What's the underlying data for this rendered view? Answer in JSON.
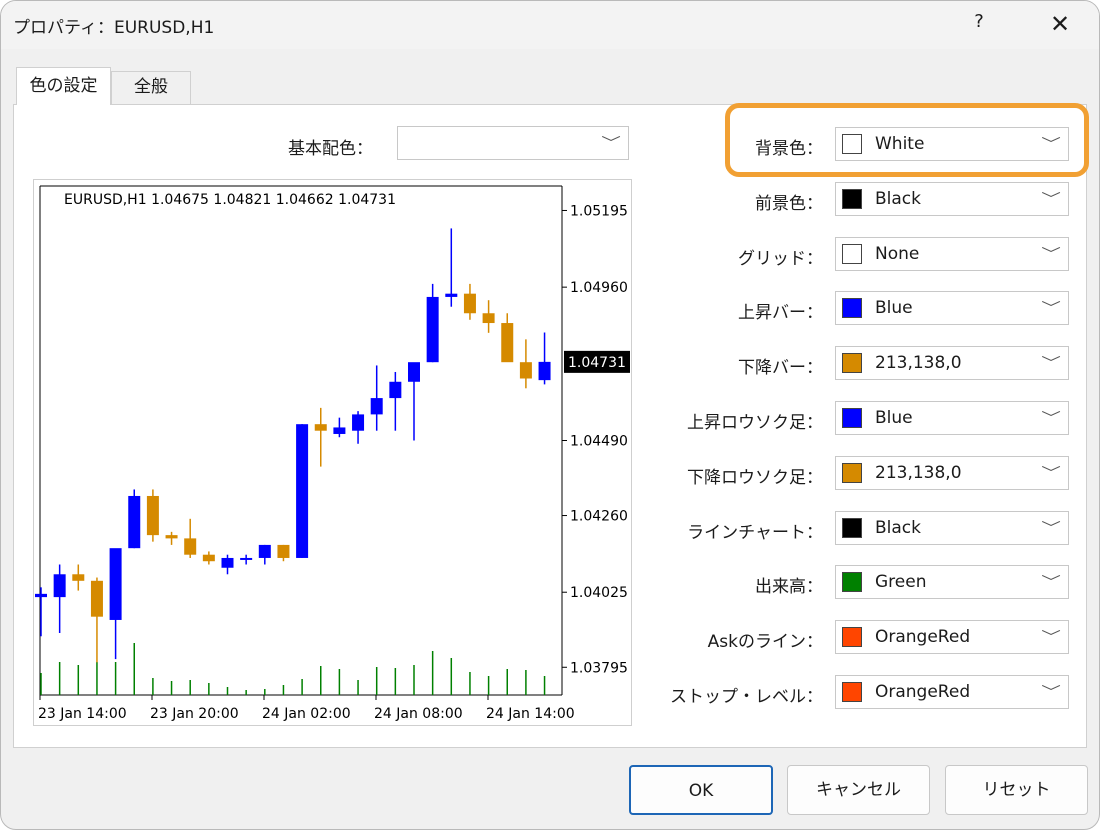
{
  "window": {
    "title": "プロパティ：EURUSD,H1",
    "help": "?",
    "close": "✕"
  },
  "tabs": [
    {
      "label": "色の設定"
    },
    {
      "label": "全般"
    }
  ],
  "scheme": {
    "label": "基本配色：",
    "value": ""
  },
  "settings": [
    {
      "label": "背景色：",
      "value": "White",
      "color": "#ffffff"
    },
    {
      "label": "前景色：",
      "value": "Black",
      "color": "#000000"
    },
    {
      "label": "グリッド：",
      "value": "None",
      "color": "#ffffff"
    },
    {
      "label": "上昇バー：",
      "value": "Blue",
      "color": "#0000ff"
    },
    {
      "label": "下降バー：",
      "value": "213,138,0",
      "color": "#d58a00"
    },
    {
      "label": "上昇ロウソク足：",
      "value": "Blue",
      "color": "#0000ff"
    },
    {
      "label": "下降ロウソク足：",
      "value": "213,138,0",
      "color": "#d58a00"
    },
    {
      "label": "ラインチャート：",
      "value": "Black",
      "color": "#000000"
    },
    {
      "label": "出来高：",
      "value": "Green",
      "color": "#008000"
    },
    {
      "label": "Askのライン：",
      "value": "OrangeRed",
      "color": "#ff4500"
    },
    {
      "label": "ストップ・レベル：",
      "value": "OrangeRed",
      "color": "#ff4500"
    }
  ],
  "buttons": {
    "ok": "OK",
    "cancel": "キャンセル",
    "reset": "リセット"
  },
  "chart_data": {
    "type": "candlestick",
    "header": "EURUSD,H1  1.04675 1.04821 1.04662 1.04731",
    "y_ticks": [
      "1.05195",
      "1.04960",
      "1.04490",
      "1.04260",
      "1.04025",
      "1.03795"
    ],
    "current_price": "1.04731",
    "x_ticks": [
      "23 Jan 14:00",
      "23 Jan 20:00",
      "24 Jan 02:00",
      "24 Jan 08:00",
      "24 Jan 14:00"
    ],
    "ylim": [
      1.0371,
      1.0527
    ],
    "up_color": "#0000ff",
    "down_color": "#d58a00",
    "volume_color": "#008000",
    "candles": [
      {
        "o": 1.0401,
        "h": 1.0404,
        "l": 1.0389,
        "c": 1.0402
      },
      {
        "o": 1.0401,
        "h": 1.0411,
        "l": 1.039,
        "c": 1.0408
      },
      {
        "o": 1.0408,
        "h": 1.0411,
        "l": 1.0403,
        "c": 1.0406
      },
      {
        "o": 1.0406,
        "h": 1.0407,
        "l": 1.0381,
        "c": 1.0395
      },
      {
        "o": 1.0394,
        "h": 1.0412,
        "l": 1.0382,
        "c": 1.0416
      },
      {
        "o": 1.0416,
        "h": 1.0434,
        "l": 1.0416,
        "c": 1.0432
      },
      {
        "o": 1.0432,
        "h": 1.0434,
        "l": 1.0418,
        "c": 1.042
      },
      {
        "o": 1.042,
        "h": 1.0421,
        "l": 1.0417,
        "c": 1.0419
      },
      {
        "o": 1.0419,
        "h": 1.0425,
        "l": 1.0413,
        "c": 1.0414
      },
      {
        "o": 1.0414,
        "h": 1.0415,
        "l": 1.0411,
        "c": 1.0412
      },
      {
        "o": 1.041,
        "h": 1.0414,
        "l": 1.0408,
        "c": 1.0413
      },
      {
        "o": 1.0413,
        "h": 1.0414,
        "l": 1.0411,
        "c": 1.0413
      },
      {
        "o": 1.0413,
        "h": 1.0417,
        "l": 1.0411,
        "c": 1.0417
      },
      {
        "o": 1.0417,
        "h": 1.0417,
        "l": 1.0412,
        "c": 1.0413
      },
      {
        "o": 1.0413,
        "h": 1.0454,
        "l": 1.0413,
        "c": 1.0454
      },
      {
        "o": 1.0454,
        "h": 1.0459,
        "l": 1.0441,
        "c": 1.0452
      },
      {
        "o": 1.0451,
        "h": 1.0456,
        "l": 1.045,
        "c": 1.0453
      },
      {
        "o": 1.0452,
        "h": 1.0458,
        "l": 1.0448,
        "c": 1.0457
      },
      {
        "o": 1.0457,
        "h": 1.0472,
        "l": 1.0452,
        "c": 1.0462
      },
      {
        "o": 1.0462,
        "h": 1.047,
        "l": 1.0452,
        "c": 1.0467
      },
      {
        "o": 1.0467,
        "h": 1.047,
        "l": 1.0449,
        "c": 1.0473
      },
      {
        "o": 1.0473,
        "h": 1.0497,
        "l": 1.0473,
        "c": 1.0493
      },
      {
        "o": 1.0493,
        "h": 1.0514,
        "l": 1.049,
        "c": 1.0494
      },
      {
        "o": 1.0494,
        "h": 1.0497,
        "l": 1.0486,
        "c": 1.0488
      },
      {
        "o": 1.0488,
        "h": 1.0492,
        "l": 1.0482,
        "c": 1.0485
      },
      {
        "o": 1.0485,
        "h": 1.0488,
        "l": 1.0474,
        "c": 1.0473
      },
      {
        "o": 1.0473,
        "h": 1.048,
        "l": 1.0465,
        "c": 1.0468
      },
      {
        "o": 1.04675,
        "h": 1.04821,
        "l": 1.04662,
        "c": 1.04731
      }
    ],
    "volumes": [
      22,
      33,
      30,
      33,
      33,
      52,
      17,
      14,
      15,
      12,
      8,
      5,
      6,
      10,
      16,
      29,
      26,
      15,
      28,
      27,
      30,
      44,
      37,
      23,
      19,
      26,
      25,
      19
    ]
  }
}
